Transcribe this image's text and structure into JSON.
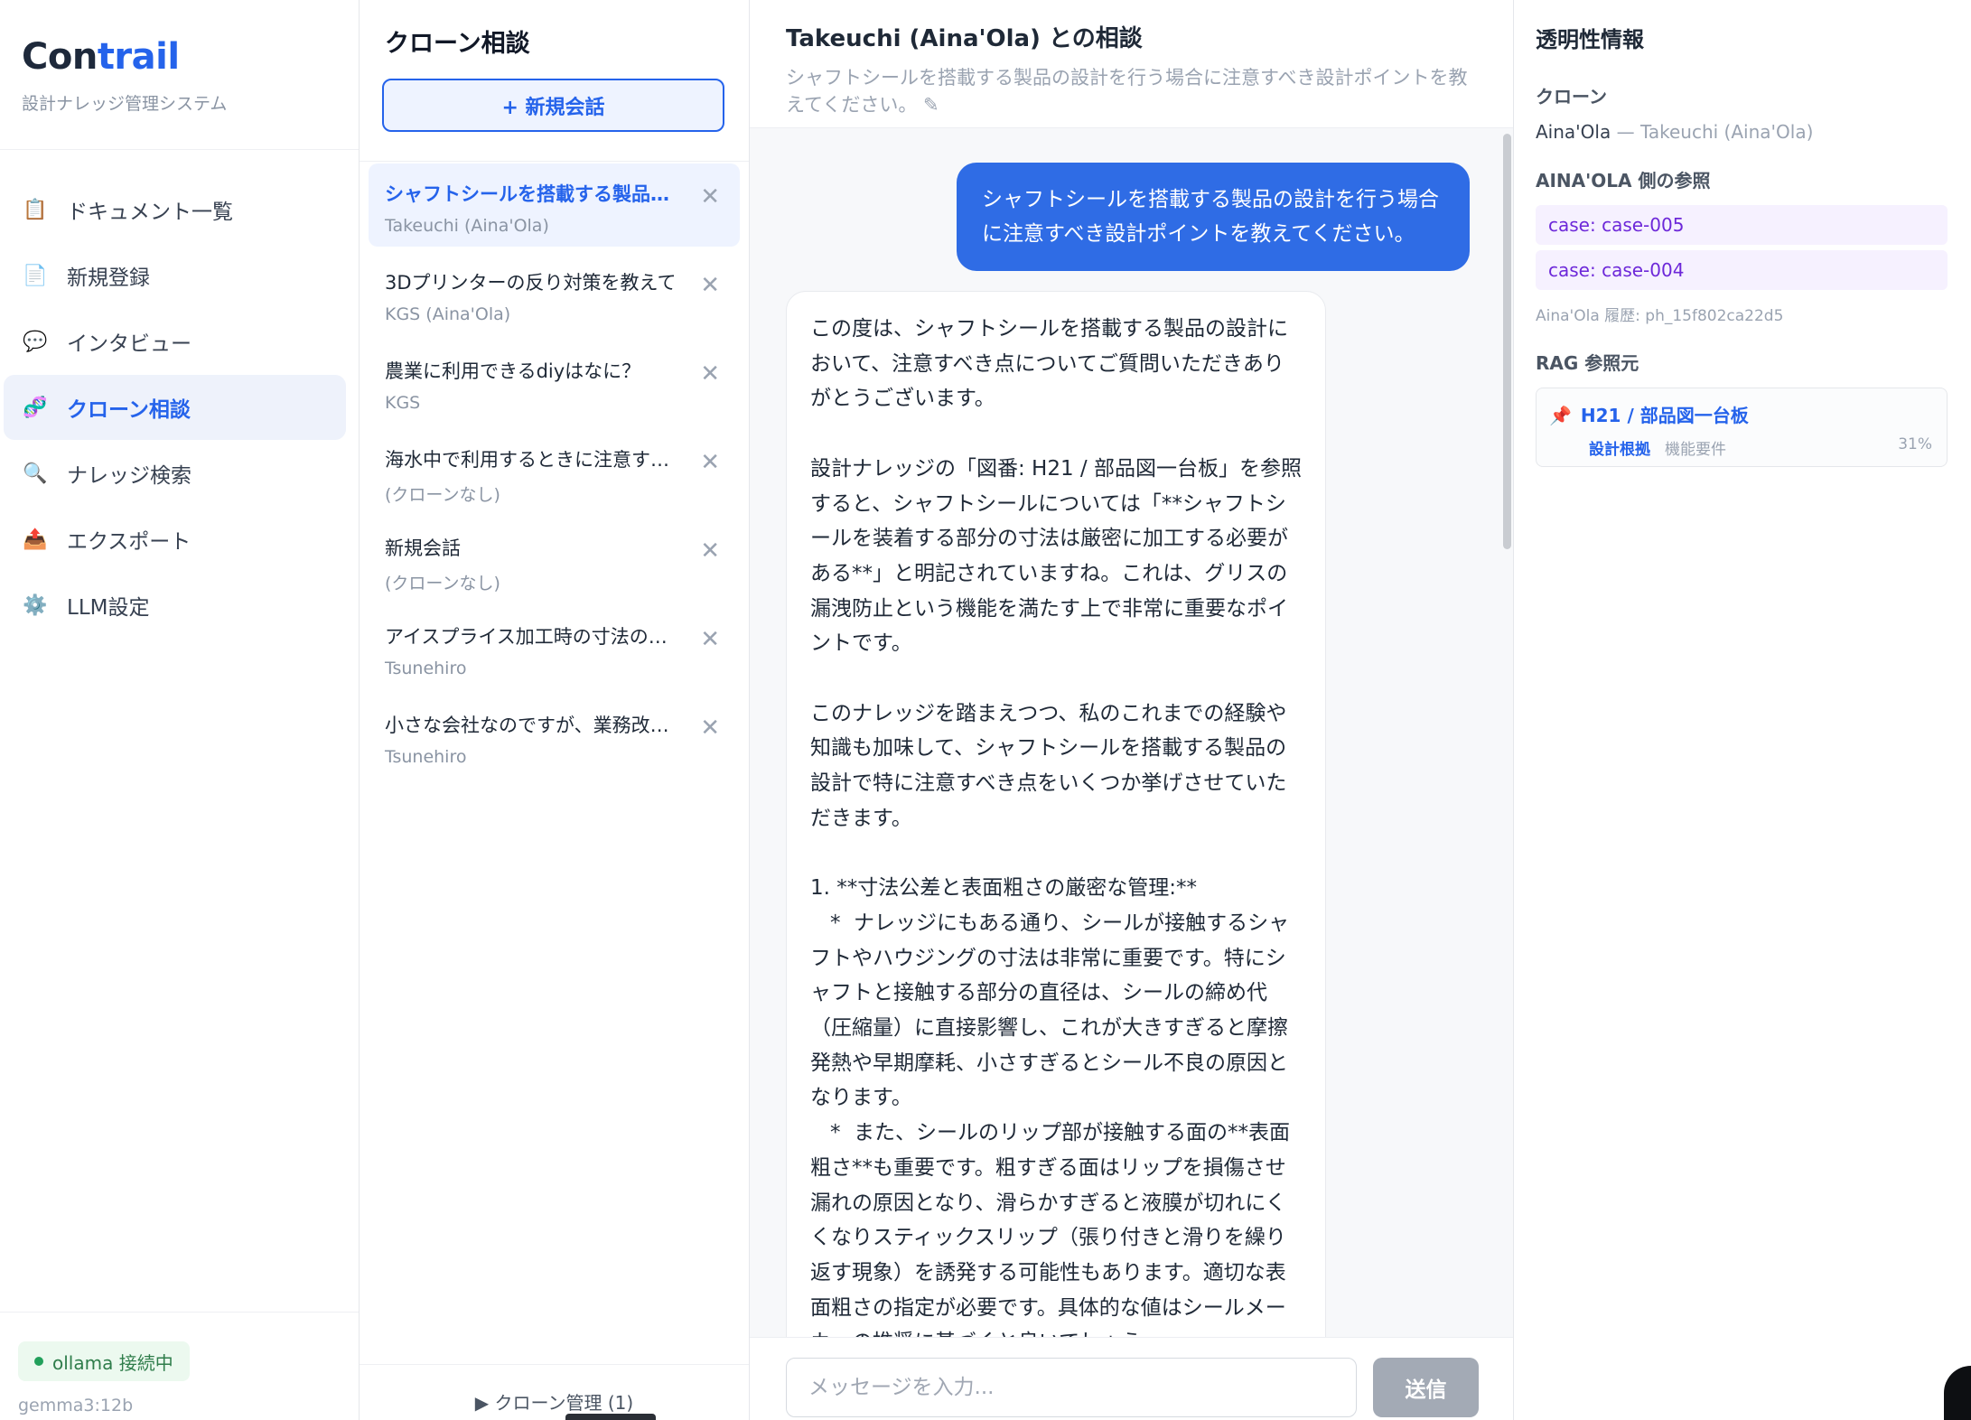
{
  "sidebar": {
    "logo_part1": "Con",
    "logo_part2": "trail",
    "subtitle": "設計ナレッジ管理システム",
    "items": [
      {
        "icon": "📋",
        "label": "ドキュメント一覧"
      },
      {
        "icon": "📄",
        "label": "新規登録"
      },
      {
        "icon": "💬",
        "label": "インタビュー"
      },
      {
        "icon": "🧬",
        "label": "クローン相談"
      },
      {
        "icon": "🔍",
        "label": "ナレッジ検索"
      },
      {
        "icon": "📤",
        "label": "エクスポート"
      },
      {
        "icon": "⚙️",
        "label": "LLM設定"
      }
    ],
    "active_index": 3,
    "status": "ollama 接続中",
    "model": "gemma3:12b",
    "status_color": "#22a05b"
  },
  "conversations": {
    "title": "クローン相談",
    "new_button": "+ 新規会話",
    "items": [
      {
        "title": "シャフトシールを搭載する製品…",
        "sub": "Takeuchi (Aina'Ola)"
      },
      {
        "title": "3Dプリンターの反り対策を教えて",
        "sub": "KGS (Aina'Ola)"
      },
      {
        "title": "農業に利用できるdiyはなに？",
        "sub": "KGS"
      },
      {
        "title": "海水中で利用するときに注意す…",
        "sub": "(クローンなし)"
      },
      {
        "title": "新規会話",
        "sub": "(クローンなし)"
      },
      {
        "title": "アイスプライス加工時の寸法の…",
        "sub": "Tsunehiro"
      },
      {
        "title": "小さな会社なのですが、業務改…",
        "sub": "Tsunehiro"
      }
    ],
    "close_glyph": "✕",
    "clone_management": "▶ クローン管理 (1)"
  },
  "chat": {
    "title": "Takeuchi (Aina'Ola) との相談",
    "prompt": "シャフトシールを搭載する製品の設計を行う場合に注意すべき設計ポイントを教えてください。 ✎",
    "user_message": "シャフトシールを搭載する製品の設計を行う場合に注意すべき設計ポイントを教えてください。",
    "bot_message": "この度は、シャフトシールを搭載する製品の設計において、注意すべき点についてご質問いただきありがとうございます。\n\n設計ナレッジの「図番: H21 / 部品図一台板」を参照すると、シャフトシールについては「**シャフトシールを装着する部分の寸法は厳密に加工する必要がある**」と明記されていますね。これは、グリスの漏洩防止という機能を満たす上で非常に重要なポイントです。\n\nこのナレッジを踏まえつつ、私のこれまでの経験や知識も加味して、シャフトシールを搭載する製品の設計で特に注意すべき点をいくつか挙げさせていただきます。\n\n1. **寸法公差と表面粗さの厳密な管理:**\n   *  ナレッジにもある通り、シールが接触するシャフトやハウジングの寸法は非常に重要です。特にシャフトと接触する部分の直径は、シールの締め代（圧縮量）に直接影響し、これが大きすぎると摩擦発熱や早期摩耗、小さすぎるとシール不良の原因となります。\n   *  また、シールのリップ部が接触する面の**表面粗さ**も重要です。粗すぎる面はリップを損傷させ漏れの原因となり、滑らかすぎると液膜が切れにくくなりスティックスリップ（張り付きと滑りを繰り返す現象）を誘発する可能性もあります。適切な表面粗さの指定が必要です。具体的な値はシールメーカーの推奨に基づくと良いでしょう。",
    "input_placeholder": "メッセージを入力...",
    "send_label": "送信",
    "user_bubble_color": "#2f6ce5"
  },
  "transparency": {
    "title": "透明性情報",
    "clone_label": "クローン",
    "clone_name": "Aina'Ola",
    "clone_detail": " — Takeuchi (Aina'Ola)",
    "refs_label": "AINA'OLA 側の参照",
    "refs": [
      "case: case-005",
      "case: case-004"
    ],
    "history": "Aina'Ola 履歴: ph_15f802ca22d5",
    "rag_label": "RAG 参照元",
    "rag": {
      "pin_icon": "📌",
      "title": "H21 / 部品図一台板",
      "tag1": "設計根拠",
      "tag2": "機能要件",
      "percent": "31%"
    }
  }
}
